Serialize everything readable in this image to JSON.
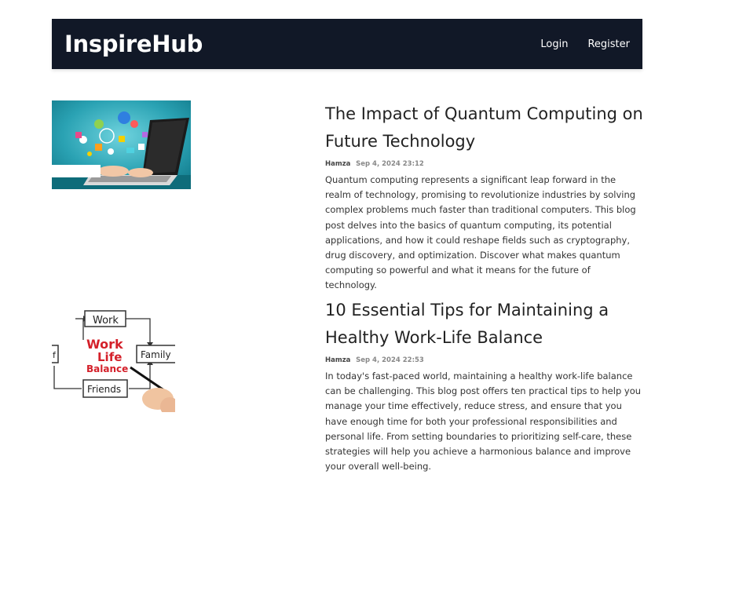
{
  "navbar": {
    "brand": "InspireHub",
    "login_label": "Login",
    "register_label": "Register"
  },
  "posts": [
    {
      "title": "The Impact of Quantum Computing on Future Technology",
      "author": "Hamza",
      "date": "Sep 4, 2024 23:12",
      "excerpt": "Quantum computing represents a significant leap forward in the realm of technology, promising to revolutionize industries by solving complex problems much faster than traditional computers. This blog post delves into the basics of quantum computing, its potential applications, and how it could reshape fields such as cryptography, drug discovery, and optimization. Discover what makes quantum computing so powerful and what it means for the future of technology."
    },
    {
      "title": "10 Essential Tips for Maintaining a Healthy Work-Life Balance",
      "author": "Hamza",
      "date": "Sep 4, 2024 22:53",
      "excerpt": "In today's fast-paced world, maintaining a healthy work-life balance can be challenging. This blog post offers ten practical tips to help you manage your time effectively, reduce stress, and ensure that you have enough time for both your professional responsibilities and personal life. From setting boundaries to prioritizing self-care, these strategies will help you achieve a harmonious balance and improve your overall well-being.",
      "image_text": {
        "work": "Work",
        "family": "Family",
        "friends": "Friends",
        "partial": "f",
        "center_1": "Work",
        "center_2": "Life",
        "center_3": "Balance"
      }
    }
  ]
}
